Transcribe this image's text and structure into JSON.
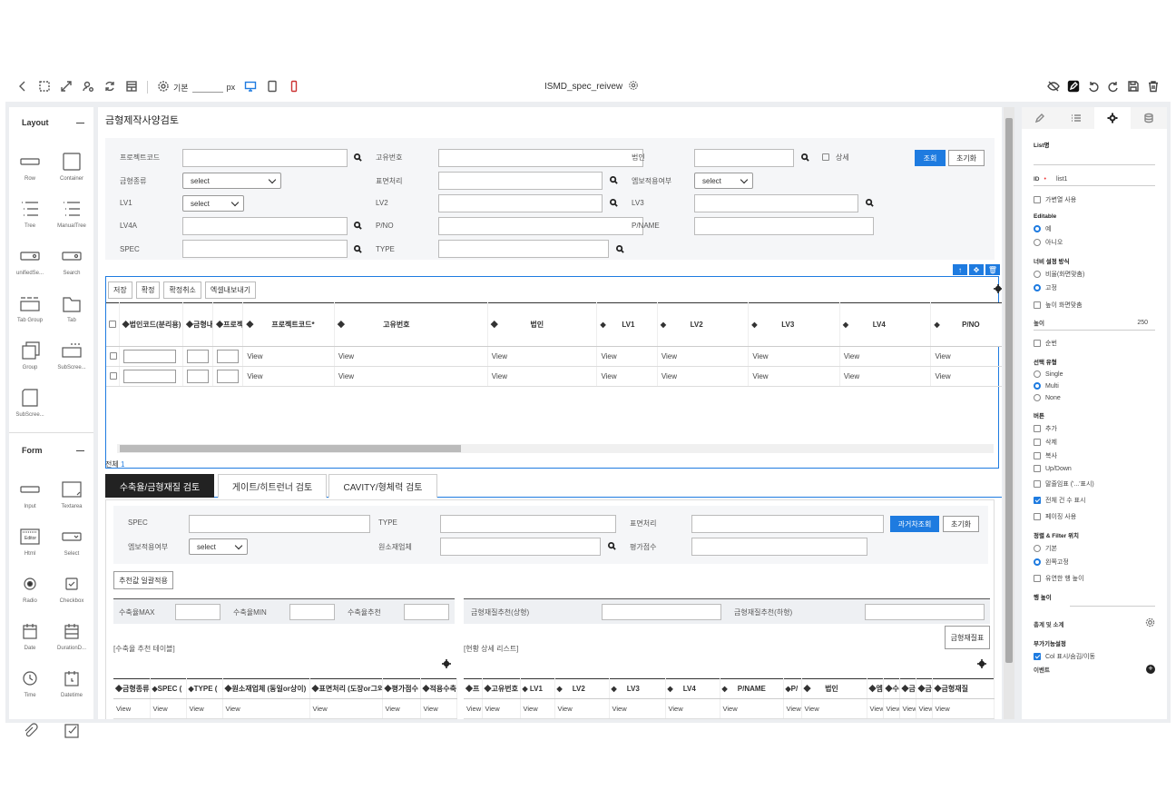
{
  "toolbar": {
    "base_label": "기본",
    "px_label": "px",
    "file_title": "ISMD_spec_reivew"
  },
  "palette": {
    "layout_title": "Layout",
    "collapse": "—",
    "layout_items": [
      "Row",
      "Container",
      "Tree",
      "ManualTree",
      "unifiedSe...",
      "Search",
      "Tab Group",
      "Tab",
      "Group",
      "SubScree...",
      "SubScree..."
    ],
    "form_title": "Form",
    "form_items": [
      "Input",
      "Textarea",
      "Html",
      "Select",
      "Radio",
      "Checkbox",
      "Date",
      "DurationD...",
      "Time",
      "Datetime"
    ]
  },
  "page": {
    "title": "금형제작사양검토"
  },
  "search": {
    "project_code": "프로젝트코드",
    "unique_no": "고유번호",
    "corp": "법인",
    "detail": "상세",
    "mold_type": "금형종류",
    "surface": "표면처리",
    "emboss": "엠보적용여부",
    "lv1": "LV1",
    "lv2": "LV2",
    "lv3": "LV3",
    "lv4a": "LV4A",
    "pno": "P/NO",
    "pname": "P/NAME",
    "spec": "SPEC",
    "type": "TYPE",
    "select": "select",
    "query": "조회",
    "reset": "초기화"
  },
  "grid": {
    "buttons": [
      "저장",
      "확정",
      "확정취소",
      "엑셀내보내기"
    ],
    "tools": [
      "↑",
      "✥",
      "🗑"
    ],
    "columns": [
      "법인코드(분리용)",
      "금형내",
      "프로젝",
      "프로젝트코드*",
      "고유번호",
      "법인",
      "LV1",
      "LV2",
      "LV3",
      "LV4",
      "P/NO"
    ],
    "rows": [
      [
        "View",
        "View",
        "View",
        "View",
        "View",
        "View",
        "View",
        "View"
      ],
      [
        "View",
        "View",
        "View",
        "View",
        "View",
        "View",
        "View",
        "View"
      ]
    ],
    "total_label": "전체",
    "total_count": "1"
  },
  "tabs": [
    "수축율/금형재질 검토",
    "게이트/히트런너 검토",
    "CAVITY/형체력 검토"
  ],
  "pane": {
    "spec": "SPEC",
    "type": "TYPE",
    "surface": "표면처리",
    "emboss": "엠보적용여부",
    "material": "원소재업체",
    "score": "평가점수",
    "select": "select",
    "history": "과거차조회",
    "reset": "초기화",
    "apply": "추천값 일괄적용",
    "shrink_max": "수축율MAX",
    "shrink_min": "수축율MIN",
    "shrink_rec": "수축율추천",
    "mat_upper": "금형재질추천(상형)",
    "mat_lower": "금형재질추천(하형)",
    "mat_table": "금형재질표",
    "left_caption": "[수축율 추천 테이블]",
    "right_caption": "[현황 상세 리스트]",
    "left_cols": [
      "금형종류",
      "SPEC (",
      "TYPE (",
      "원소재업체 (동일or상이)",
      "표면처리 (도장or그외",
      "평가점수",
      "적용수축"
    ],
    "left_row": [
      "View",
      "View",
      "View",
      "View",
      "View",
      "View",
      "View"
    ],
    "right_cols": [
      "프",
      "고유번호",
      "LV1",
      "LV2",
      "LV3",
      "LV4",
      "P/NAME",
      "P/",
      "법인",
      "엠",
      "수",
      "금",
      "금",
      "금형재질"
    ],
    "right_row": [
      "View",
      "View",
      "View",
      "View",
      "View",
      "View",
      "View",
      "View",
      "View",
      "View",
      "View",
      "View",
      "View",
      "View"
    ]
  },
  "props": {
    "list_name_label": "List명",
    "id_label": "ID",
    "id_value": "list1",
    "variable_list": "가변열 사용",
    "editable": "Editable",
    "yes": "예",
    "no": "아니오",
    "width_mode": "너비 설정 방식",
    "ratio": "비율(화면맞춤)",
    "fixed": "고정",
    "fit_height": "높이 화면맞춤",
    "height_label": "높이",
    "height_value": "250",
    "order": "순번",
    "select_type": "선택 유형",
    "single": "Single",
    "multi": "Multi",
    "none": "None",
    "buttons": "버튼",
    "add": "추가",
    "delete": "삭제",
    "copy": "복사",
    "updown": "Up/Down",
    "ellipsis": "말줄임표 ('...'표시)",
    "total_count": "전체 건 수 표시",
    "paging": "페이징 사용",
    "sort_filter": "정렬 & Filter 위치",
    "basic": "기본",
    "left_fixed": "왼쪽고정",
    "flex_row": "유연한 행 높이",
    "row_height": "행 높이",
    "sum": "총계 및 소계",
    "extra": "부가기능설정",
    "col_show": "Col 표시/숨김/이동",
    "more": "이벤트"
  }
}
